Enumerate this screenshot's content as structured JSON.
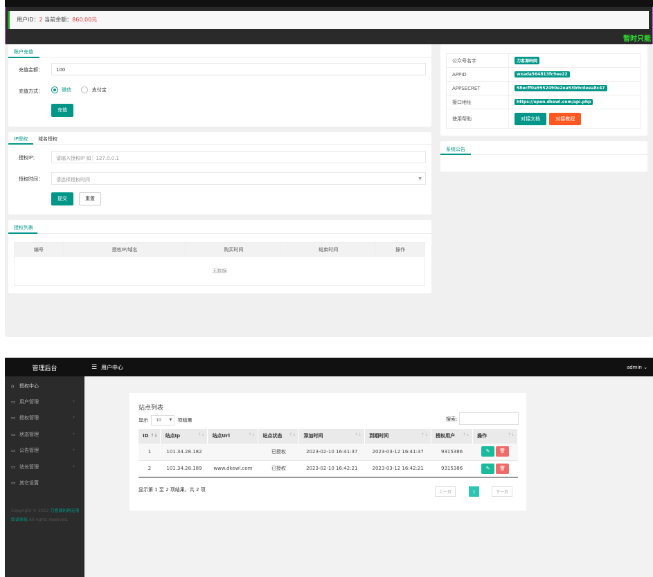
{
  "top": {
    "notice": {
      "prefix": "用户ID：",
      "user_id": "2",
      "middle": " 当前余额：",
      "balance": "860.00元"
    },
    "marquee": "暂时只能",
    "recharge": {
      "title": "账户充值",
      "amount_label": "充值金额：",
      "amount_value": "100",
      "method_label": "充值方式：",
      "methods": [
        "微信",
        "支付宝"
      ],
      "submit": "充值"
    },
    "auth_form": {
      "tabs": [
        "IP授权",
        "域名授权"
      ],
      "ip_label": "授权IP：",
      "ip_placeholder": "请输入授权IP 如：127.0.0.1",
      "time_label": "授权时间：",
      "time_placeholder": "请选择授权时间",
      "submit": "提交",
      "reset": "重置"
    },
    "auth_list": {
      "title": "授权列表",
      "columns": [
        "编号",
        "授权IP/域名",
        "购买时间",
        "结束时间",
        "操作"
      ],
      "empty": "无数据"
    },
    "info": {
      "rows": [
        {
          "key": "公众号名字",
          "value": "刀客源码网"
        },
        {
          "key": "APPID",
          "value": "wxada564813fc9ee22"
        },
        {
          "key": "APPSECRET",
          "value": "58ecff0a9952490e2ea53b9cdeea8c47"
        },
        {
          "key": "接口地址",
          "value": "https://open.dkewl.com/api.php"
        }
      ],
      "help_label": "使用帮助",
      "btn_docs": "对接文档",
      "btn_tutorial": "对接教程"
    },
    "announcement": {
      "title": "系统公告"
    }
  },
  "bottom": {
    "brand": "管理后台",
    "header_title": "用户中心",
    "admin": "admin",
    "sidebar": [
      {
        "label": "授权中心",
        "icon": "home-icon"
      },
      {
        "label": "用户管理",
        "icon": "monitor-icon"
      },
      {
        "label": "授权管理",
        "icon": "monitor-icon"
      },
      {
        "label": "状态管理",
        "icon": "monitor-icon"
      },
      {
        "label": "公告管理",
        "icon": "monitor-icon"
      },
      {
        "label": "站长管理",
        "icon": "monitor-icon"
      },
      {
        "label": "其它设置",
        "icon": "monitor-icon"
      }
    ],
    "copyright": {
      "pre": "Copyright © 2022",
      "link": "刀客源码网无限回调系统",
      "post": " All rights reserved."
    },
    "card": {
      "title": "站点列表",
      "show_pre": "显示",
      "page_size": "10",
      "show_post": "项结果",
      "search_label": "搜索:",
      "columns": [
        "ID",
        "站点Ip",
        "站点Url",
        "站点状态",
        "添加时间",
        "到期时间",
        "授权用户",
        "操作"
      ],
      "rows": [
        {
          "id": "1",
          "ip": "101.34.28.182",
          "url": "",
          "status": "已授权",
          "added": "2023-02-10 16:41:37",
          "expires": "2023-03-12 16:41:37",
          "user": "9315386"
        },
        {
          "id": "2",
          "ip": "101.34.28.189",
          "url": "www.dkewl.com",
          "status": "已授权",
          "added": "2023-02-10 16:42:21",
          "expires": "2023-03-12 16:42:21",
          "user": "9315386"
        }
      ],
      "footer": "显示第 1 至 2 项结果，共 2 项",
      "prev": "上一页",
      "current_page": "1",
      "next": "下一页"
    },
    "colors": {
      "accent": "#009688",
      "edit": "#1abb9c",
      "delete": "#f06a6a"
    }
  }
}
